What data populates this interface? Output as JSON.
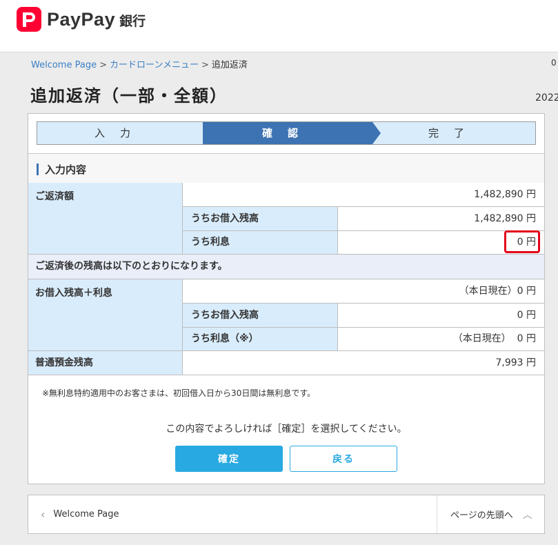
{
  "brand": {
    "name": "PayPay",
    "suffix": "銀行",
    "icon": "paypay-logo-icon",
    "color": "#ff0033"
  },
  "breadcrumb": {
    "items": [
      "Welcome Page",
      "カードローンメニュー"
    ],
    "current": "追加返済",
    "separator": ">"
  },
  "edge_cut": {
    "top_right": "0",
    "date_partial": "2022"
  },
  "page_title": "追加返済（一部・全額）",
  "steps": [
    {
      "label": "入力",
      "state": "done"
    },
    {
      "label": "確認",
      "state": "active"
    },
    {
      "label": "完了",
      "state": "pending"
    }
  ],
  "section_title": "入力内容",
  "repayment": {
    "label": "ご返済額",
    "total": "1,482,890 円",
    "principal_label": "うちお借入残高",
    "principal": "1,482,890 円",
    "interest_label": "うち利息",
    "interest": "0 円"
  },
  "after_notice": "ご返済後の残高は以下のとおりになります。",
  "balance": {
    "label": "お借入残高＋利息",
    "total": "（本日現在）0 円",
    "principal_label": "うちお借入残高",
    "principal": "0 円",
    "interest_label": "うち利息（※）",
    "interest": "（本日現在）  0 円"
  },
  "deposit": {
    "label": "普通預金残高",
    "value": "7,993 円"
  },
  "footnote": "※無利息特約適用中のお客さまは、初回借入日から30日間は無利息です。",
  "confirm_message": "この内容でよろしければ［確定］を選択してください。",
  "buttons": {
    "confirm": "確定",
    "back": "戻る"
  },
  "footer": {
    "back_link": "Welcome Page",
    "top_link": "ページの先頭へ"
  },
  "colors": {
    "accent": "#3d73b2",
    "button": "#29a9e1",
    "label_bg": "#d9ecfb",
    "highlight": "#e2001a"
  }
}
